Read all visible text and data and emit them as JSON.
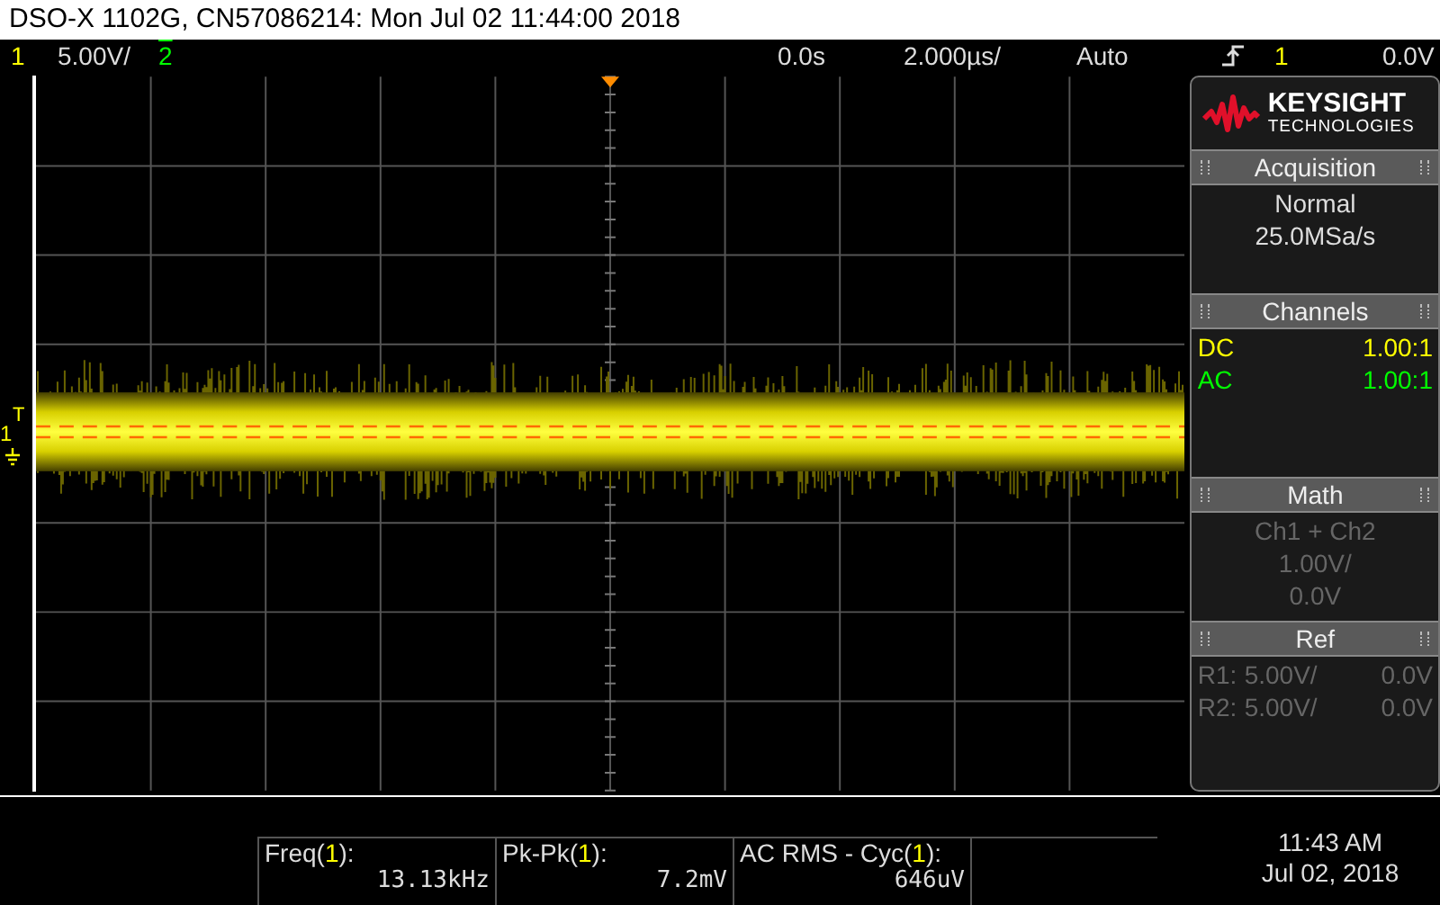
{
  "title": "DSO-X 1102G, CN57086214: Mon Jul 02 11:44:00 2018",
  "status_bar": {
    "channels": [
      {
        "label": "1",
        "scale": "5.00V/",
        "on": true,
        "color": "#ffff00"
      },
      {
        "label": "2",
        "on": false,
        "color": "#00ff00"
      }
    ],
    "delay": "0.0s",
    "timebase": "2.000µs/",
    "trigger_mode": "Auto",
    "trigger_source": "1",
    "trigger_level": "0.0V"
  },
  "markers": {
    "trigger": "T",
    "channel": "1"
  },
  "panel": {
    "logo": {
      "name": "KEYSIGHT",
      "sub": "TECHNOLOGIES"
    },
    "acquisition": {
      "title": "Acquisition",
      "lines": [
        "Normal",
        "25.0MSa/s"
      ]
    },
    "channels": {
      "title": "Channels",
      "rows": [
        {
          "coupling": "DC",
          "probe": "1.00:1",
          "color": "#ffff00"
        },
        {
          "coupling": "AC",
          "probe": "1.00:1",
          "color": "#00ff00"
        }
      ]
    },
    "math": {
      "title": "Math",
      "disabled": true,
      "lines": [
        "Ch1 + Ch2",
        "1.00V/",
        "0.0V"
      ]
    },
    "ref": {
      "title": "Ref",
      "rows": [
        {
          "name": "R1:",
          "scale": "5.00V/",
          "offset": "0.0V"
        },
        {
          "name": "R2:",
          "scale": "5.00V/",
          "offset": "0.0V"
        }
      ]
    }
  },
  "measurements": [
    {
      "prefix": "Freq(",
      "channel": "1",
      "suffix": "):",
      "value": "13.13kHz"
    },
    {
      "prefix": "Pk-Pk(",
      "channel": "1",
      "suffix": "):",
      "value": "7.2mV"
    },
    {
      "prefix": "AC RMS - Cyc(",
      "channel": "1",
      "suffix": "):",
      "value": "646uV"
    }
  ],
  "clock": {
    "time": "11:43 AM",
    "date": "Jul 02, 2018"
  }
}
